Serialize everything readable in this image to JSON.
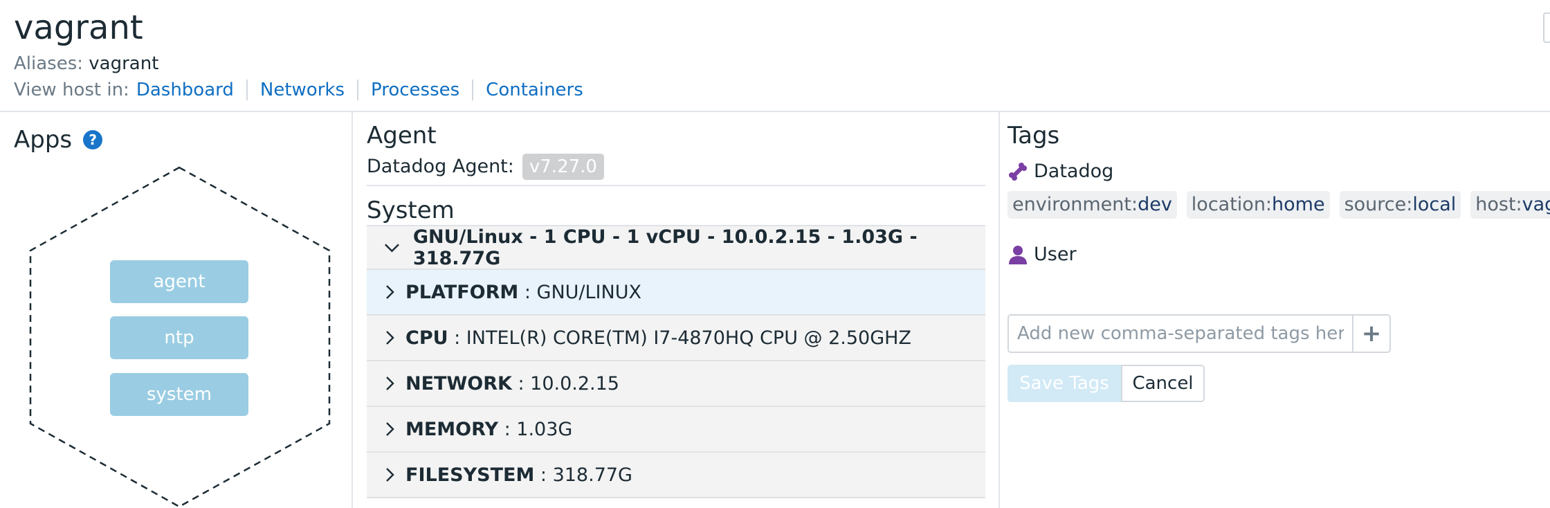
{
  "host": {
    "name": "vagrant",
    "aliases_label": "Aliases:",
    "aliases_value": "vagrant",
    "view_in_label": "View host in:",
    "links": {
      "dashboard": "Dashboard",
      "networks": "Networks",
      "processes": "Processes",
      "containers": "Containers"
    }
  },
  "apps": {
    "title": "Apps",
    "help_icon": "question-circle-icon",
    "items": [
      "agent",
      "ntp",
      "system"
    ]
  },
  "agent": {
    "title": "Agent",
    "label": "Datadog Agent:",
    "version": "v7.27.0"
  },
  "system": {
    "title": "System",
    "summary": "GNU/Linux - 1 CPU - 1 vCPU - 10.0.2.15 - 1.03G - 318.77G",
    "rows": [
      {
        "key": "PLATFORM",
        "value": " : GNU/LINUX"
      },
      {
        "key": "CPU",
        "value": " : INTEL(R) CORE(TM) I7-4870HQ CPU @ 2.50GHZ"
      },
      {
        "key": "NETWORK",
        "value": " : 10.0.2.15"
      },
      {
        "key": "MEMORY",
        "value": " : 1.03G"
      },
      {
        "key": "FILESYSTEM",
        "value": " : 318.77G"
      }
    ]
  },
  "tags": {
    "title": "Tags",
    "datadog_group": "Datadog",
    "datadog_icon": "bone-icon",
    "chips": [
      {
        "key": "environment:",
        "value": "dev"
      },
      {
        "key": "location:",
        "value": "home"
      },
      {
        "key": "source:",
        "value": "local"
      },
      {
        "key": "host:",
        "value": "vagrant"
      }
    ],
    "user_group": "User",
    "user_icon": "user-icon",
    "input_placeholder": "Add new comma-separated tags here",
    "add_symbol": "+",
    "save_label": "Save Tags",
    "cancel_label": "Cancel"
  },
  "colors": {
    "link": "#0f6ec2",
    "icon_purple": "#7a3fa3",
    "app_pill": "#9acde3",
    "highlight_row": "#e8f3fb"
  }
}
